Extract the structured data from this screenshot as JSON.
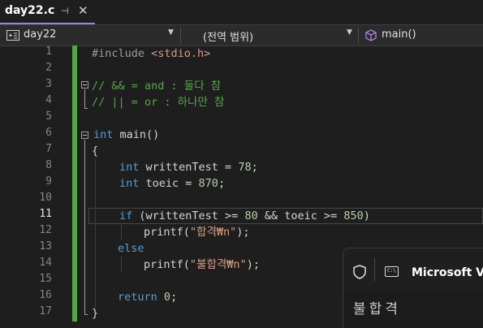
{
  "tab": {
    "title": "day22.c",
    "pin_glyph": "⊣",
    "close_glyph": "✕"
  },
  "navbar": {
    "project": "day22",
    "scope": "(전역 범위)",
    "member": "main()"
  },
  "lines": [
    {
      "num": "1"
    },
    {
      "num": "2"
    },
    {
      "num": "3"
    },
    {
      "num": "4"
    },
    {
      "num": "5"
    },
    {
      "num": "6"
    },
    {
      "num": "7"
    },
    {
      "num": "8"
    },
    {
      "num": "9"
    },
    {
      "num": "10"
    },
    {
      "num": "11"
    },
    {
      "num": "12"
    },
    {
      "num": "13"
    },
    {
      "num": "14"
    },
    {
      "num": "15"
    },
    {
      "num": "16"
    },
    {
      "num": "17"
    }
  ],
  "code": {
    "l1_pp": "#include ",
    "l1_inc": "<stdio.h>",
    "l3": "// && = and : 둘다 참",
    "l4": "// || = or : 하나만 참",
    "l6_kw": "int",
    "l6_rest": " main()",
    "l7": "{",
    "l8_kw": "int",
    "l8_rest": " writtenTest = ",
    "l8_num": "78",
    "l8_end": ";",
    "l9_kw": "int",
    "l9_rest": " toeic = ",
    "l9_num": "870",
    "l9_end": ";",
    "l11_kw": "if",
    "l11_a": " (writtenTest >= ",
    "l11_n1": "80",
    "l11_b": " && toeic >= ",
    "l11_n2": "850",
    "l11_c": ")",
    "l12_fn": "printf",
    "l12_a": "(",
    "l12_str": "\"합격₩n\"",
    "l12_b": ");",
    "l13_kw": "else",
    "l14_fn": "printf",
    "l14_a": "(",
    "l14_str": "\"불합격₩n\"",
    "l14_b": ");",
    "l16_kw": "return",
    "l16_sp": " ",
    "l16_num": "0",
    "l16_end": ";",
    "l17": "}"
  },
  "console_popup": {
    "title": "Microsoft Vis",
    "output": "불합격"
  },
  "colors": {
    "keyword": "#569cd6",
    "number": "#b5cea8",
    "string": "#d69d85",
    "comment": "#57a64a",
    "accent": "#9184ee"
  }
}
